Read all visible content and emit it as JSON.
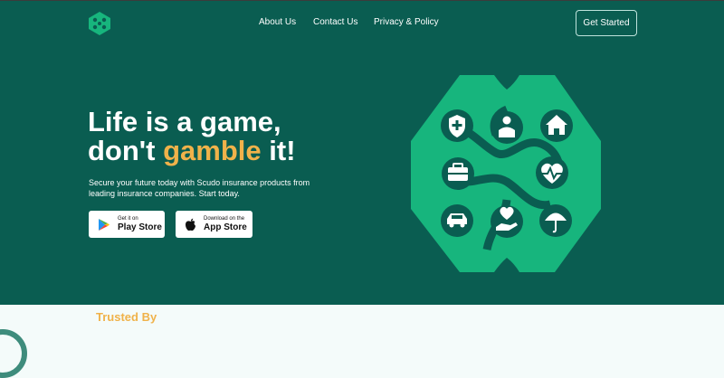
{
  "header": {
    "logo_icon": "scudo-logo-icon",
    "nav": {
      "about": "About Us",
      "contact": "Contact Us",
      "privacy": "Privacy & Policy"
    },
    "cta": "Get Started"
  },
  "hero": {
    "headline_line1": "Life is a game,",
    "headline_pre": "don't ",
    "headline_accent": "gamble",
    "headline_post": " it!",
    "subtitle": "Secure your future today with Scudo insurance products from leading insurance companies. Start today.",
    "play_store": {
      "small": "Get it on",
      "big": "Play Store",
      "icon": "google-play-icon"
    },
    "app_store": {
      "small": "Download on the",
      "big": "App Store",
      "icon": "apple-icon"
    },
    "illustration_icons": [
      "shield-plus-icon",
      "person-icon",
      "house-icon",
      "briefcase-icon",
      "heartbeat-icon",
      "car-icon",
      "hand-heart-icon",
      "umbrella-icon"
    ]
  },
  "trusted": {
    "title": "Trusted By"
  },
  "colors": {
    "primary": "#0a5d51",
    "accent": "#f0b24a",
    "hex_green": "#17b57d"
  }
}
